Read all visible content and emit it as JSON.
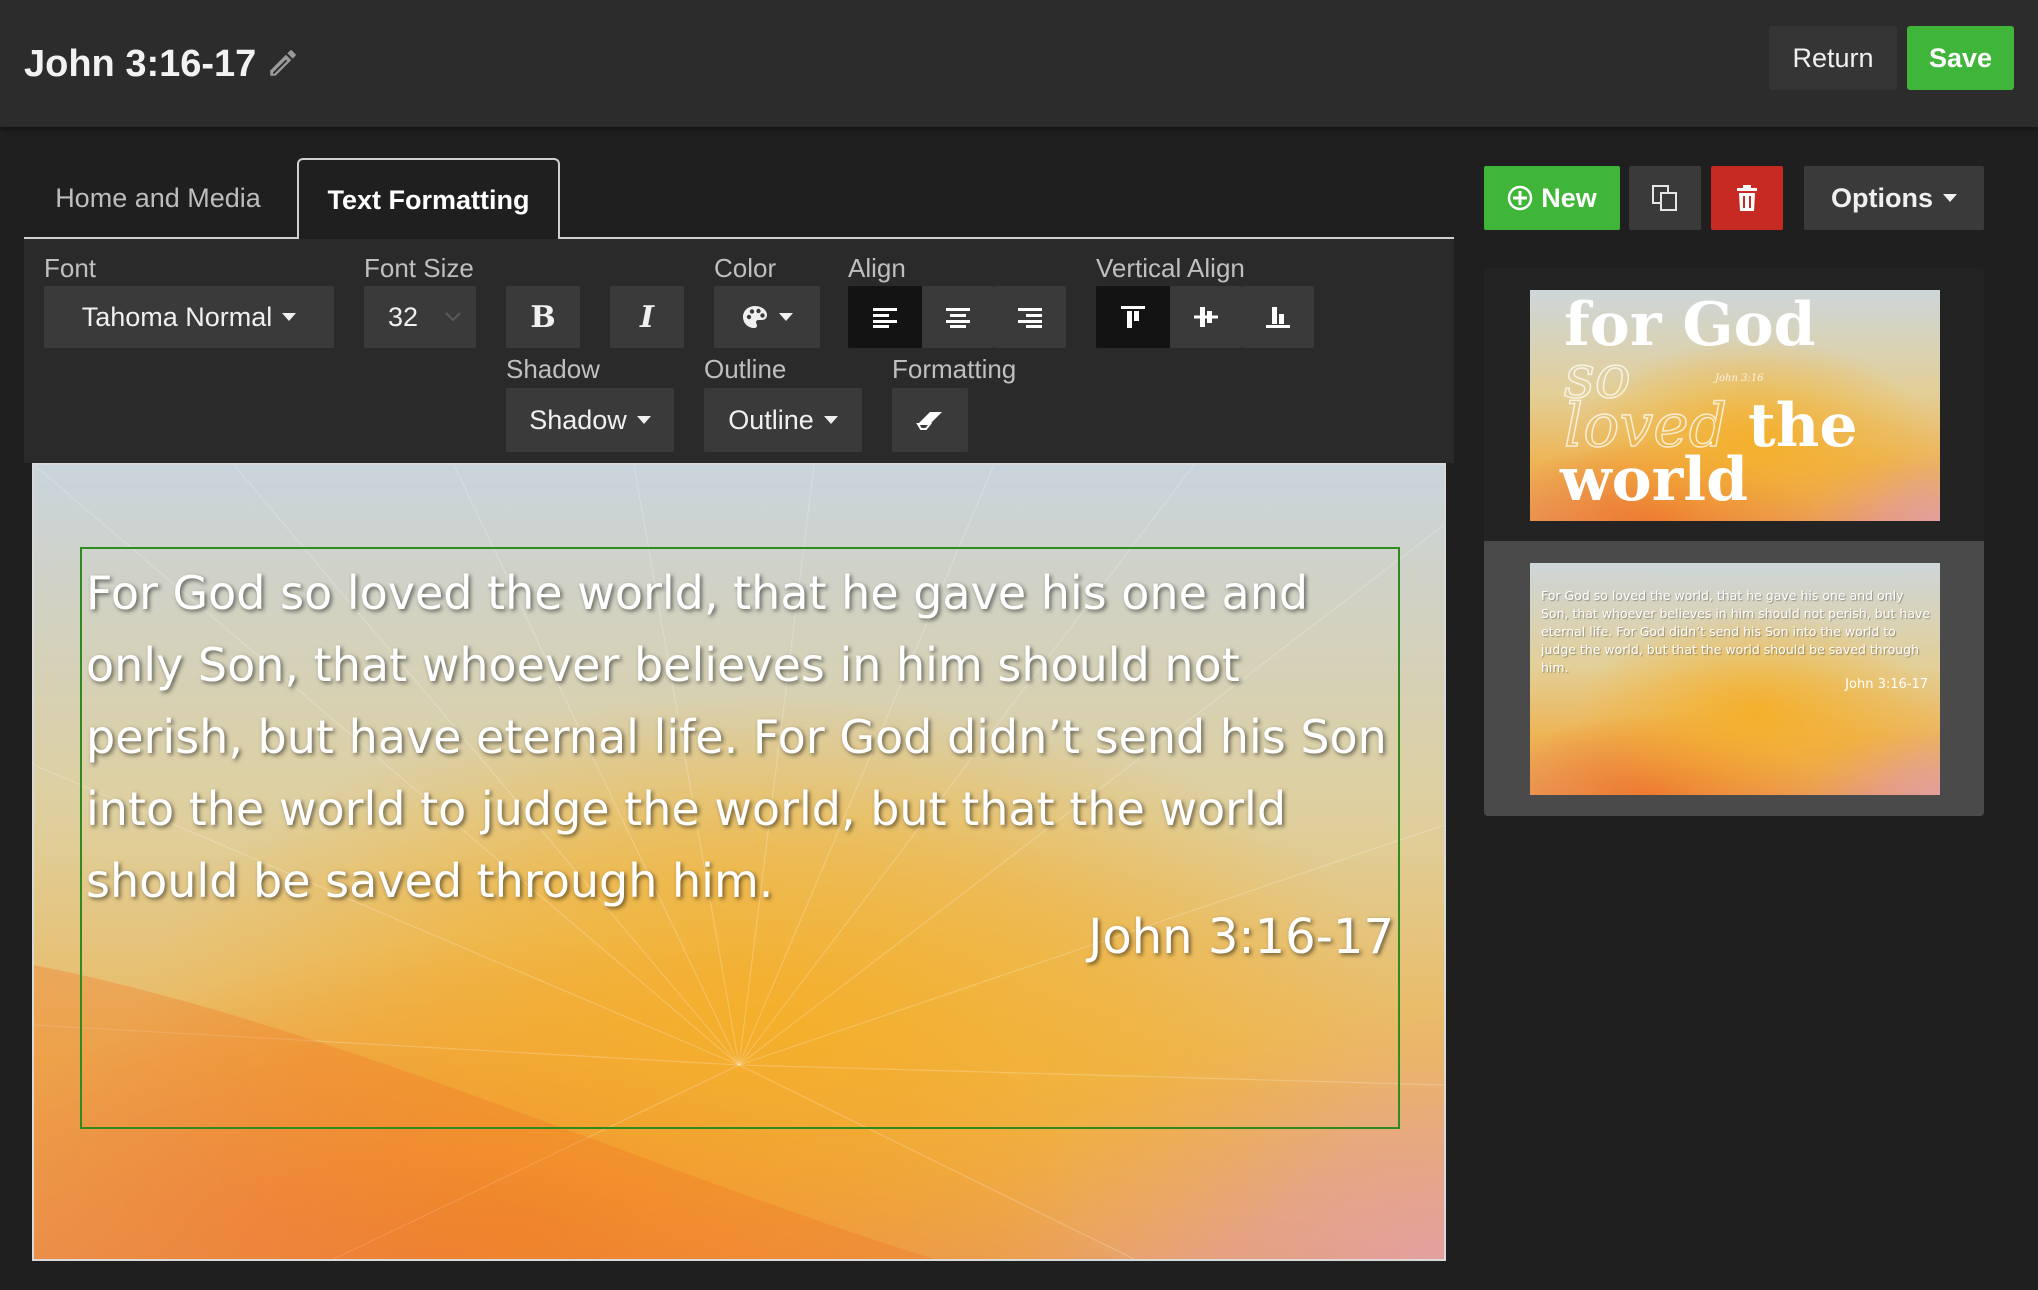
{
  "header": {
    "title": "John 3:16-17",
    "return_label": "Return",
    "save_label": "Save"
  },
  "tabs": [
    {
      "label": "Home and Media",
      "active": false
    },
    {
      "label": "Text Formatting",
      "active": true
    }
  ],
  "toolbar": {
    "font_label": "Font",
    "font_value": "Tahoma Normal",
    "font_size_label": "Font Size",
    "font_size_value": "32",
    "bold_label": "B",
    "italic_label": "I",
    "color_label": "Color",
    "align_label": "Align",
    "align_active": "left",
    "vertical_align_label": "Vertical Align",
    "vertical_align_active": "top",
    "shadow_label": "Shadow",
    "shadow_value": "Shadow",
    "outline_label": "Outline",
    "outline_value": "Outline",
    "formatting_label": "Formatting"
  },
  "editor": {
    "verse_text": "For God so loved the world, that he gave his one and only Son, that whoever believes in him should not perish, but have eternal life. For God didn’t send his Son into the world to judge the world, but that the world should be saved through him.",
    "reference": "John 3:16-17"
  },
  "sidebar": {
    "new_label": "New",
    "options_label": "Options",
    "slides": [
      {
        "words": [
          "for God",
          "so",
          "loved",
          "the",
          "world"
        ],
        "small_ref": "John 3:16",
        "selected": false
      },
      {
        "text": "For God so loved the world, that he gave his one and only Son, that whoever believes in him should not perish, but have eternal life. For God didn’t send his Son into the world to judge the world, but that the world should be saved through him.",
        "reference": "John 3:16-17",
        "selected": true
      }
    ]
  },
  "colors": {
    "save_green": "#3fb63a",
    "delete_red": "#c62a22",
    "textbox_border": "#2f8a1f"
  }
}
